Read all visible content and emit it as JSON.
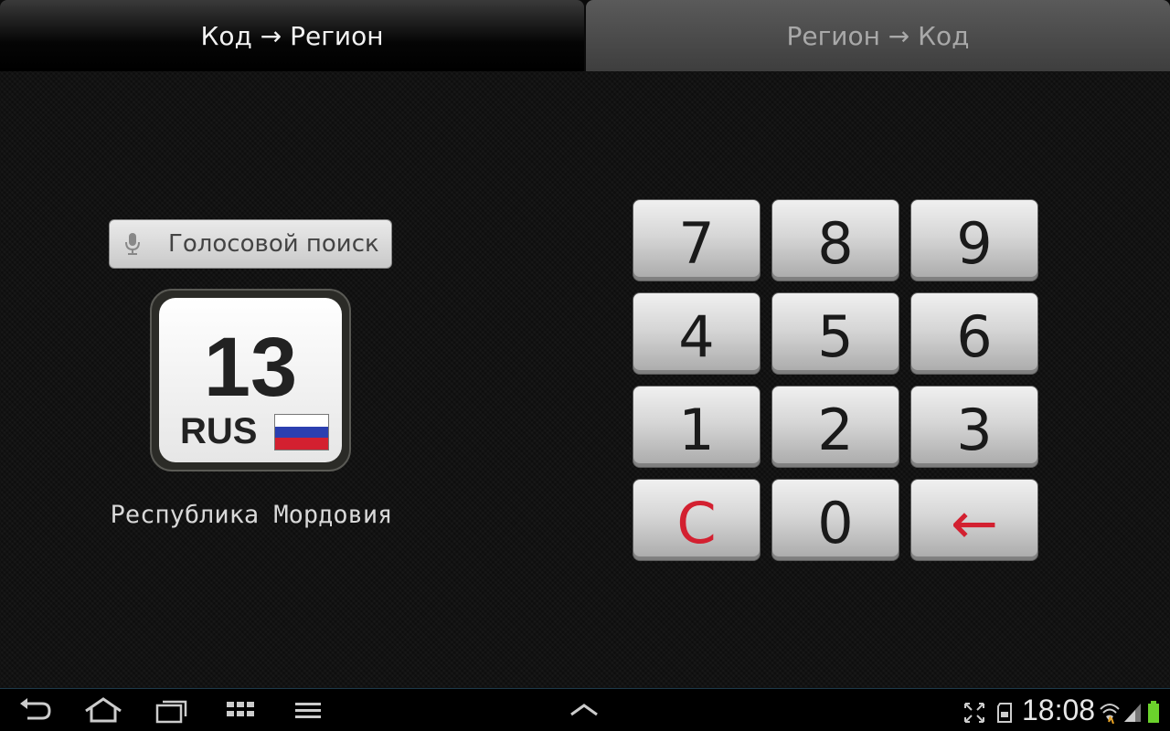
{
  "tabs": [
    {
      "label": "Код → Регион",
      "active": true
    },
    {
      "label": "Регион → Код",
      "active": false
    }
  ],
  "voice_search": {
    "label": "Голосовой поиск",
    "icon": "microphone-icon"
  },
  "plate": {
    "code": "13",
    "country": "RUS",
    "flag_colors": [
      "#ffffff",
      "#2b3fb0",
      "#d32030"
    ]
  },
  "region_name": "Республика Мордовия",
  "keypad": {
    "keys": [
      "7",
      "8",
      "9",
      "4",
      "5",
      "6",
      "1",
      "2",
      "3",
      "C",
      "0",
      "←"
    ],
    "accent_color": "#d32030"
  },
  "status_bar": {
    "time": "18:08",
    "icons": [
      "back-icon",
      "home-icon",
      "recent-apps-icon",
      "apps-grid-icon",
      "menu-icon",
      "expand-up-icon",
      "screenshot-icon",
      "sd-card-icon",
      "wifi-icon",
      "signal-icon",
      "battery-icon"
    ]
  }
}
